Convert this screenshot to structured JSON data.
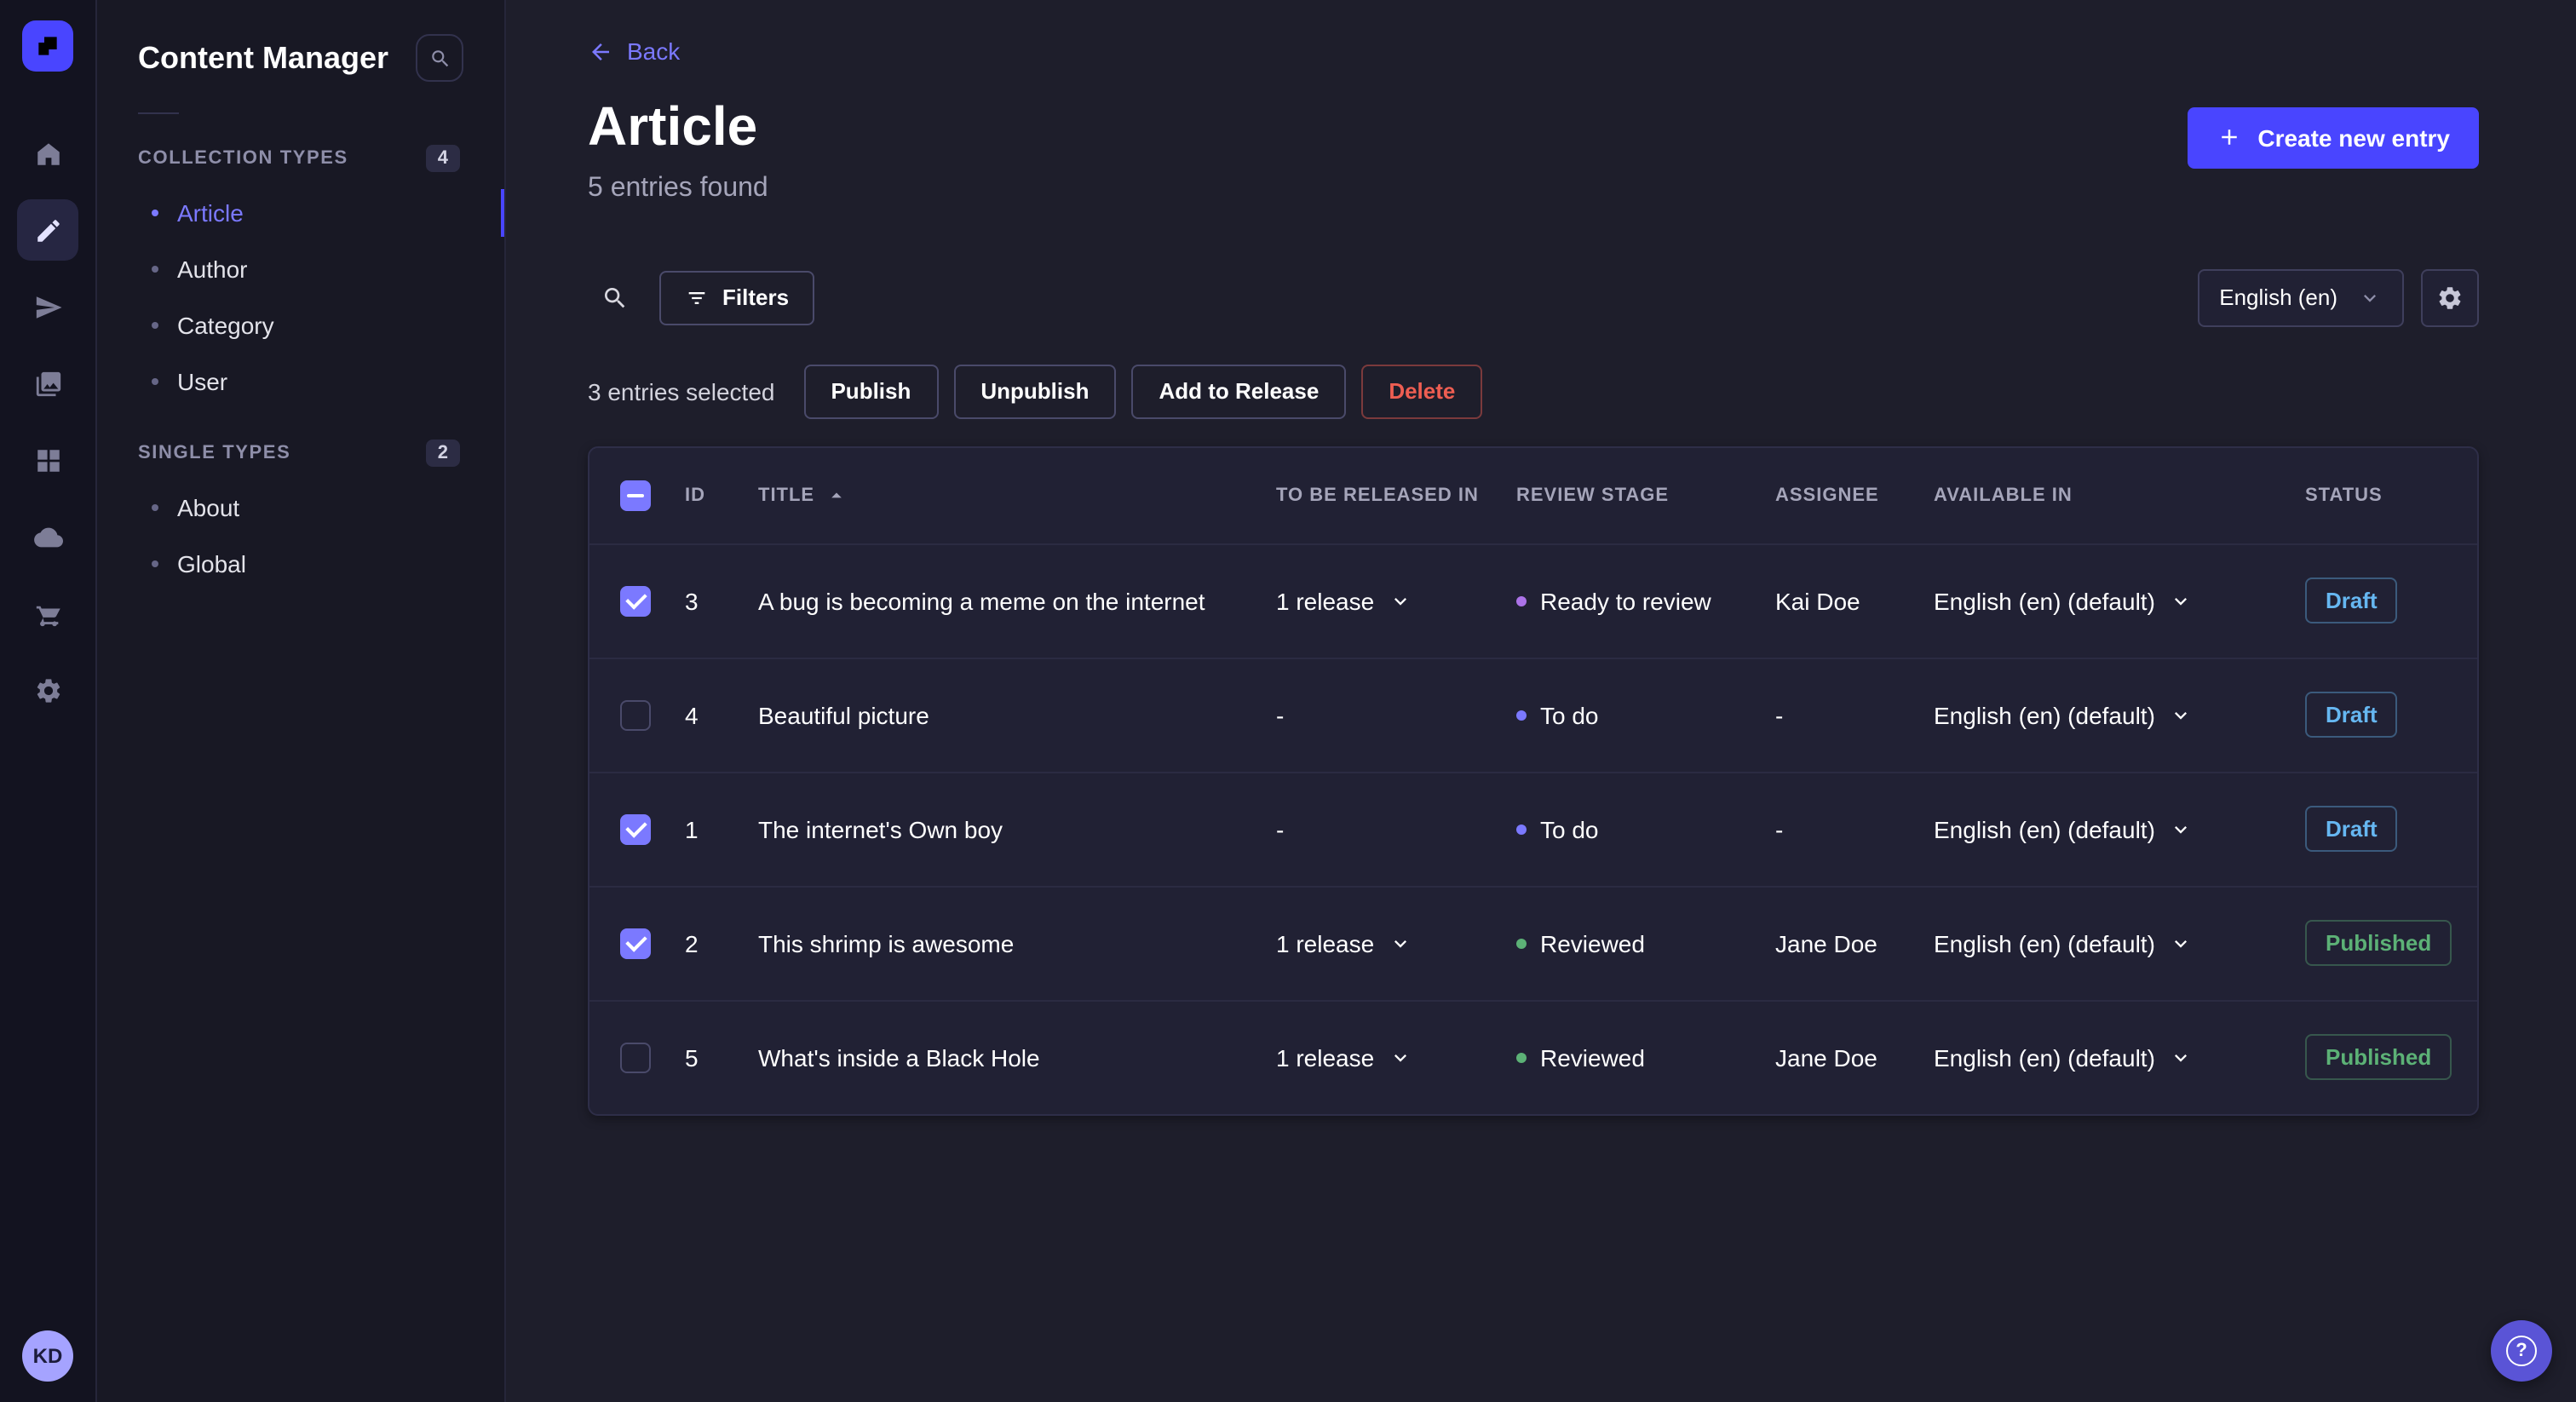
{
  "colors": {
    "accent": "#4945ff",
    "accent_light": "#7b79ff",
    "draft_status": "#66b7f1",
    "published_status": "#5cb176",
    "danger": "#ee5e52",
    "stage_ready_to_review": "#ac73e8",
    "stage_to_do": "#7b79ff",
    "stage_reviewed": "#5cb176"
  },
  "rail": {
    "logo_icon": "strapi-logo",
    "items": [
      {
        "name": "home",
        "icon": "home-icon"
      },
      {
        "name": "content-manager",
        "icon": "content-manager-icon",
        "active": true
      },
      {
        "name": "releases",
        "icon": "releases-icon"
      },
      {
        "name": "media-library",
        "icon": "media-library-icon"
      },
      {
        "name": "content-type-builder",
        "icon": "content-type-builder-icon"
      },
      {
        "name": "deployments",
        "icon": "cloud-icon"
      },
      {
        "name": "marketplace",
        "icon": "cart-icon"
      },
      {
        "name": "settings",
        "icon": "gear-icon"
      }
    ],
    "avatar_initials": "KD"
  },
  "sidebar": {
    "title": "Content Manager",
    "sections": [
      {
        "label": "COLLECTION TYPES",
        "badge": "4",
        "items": [
          {
            "label": "Article",
            "active": true
          },
          {
            "label": "Author"
          },
          {
            "label": "Category"
          },
          {
            "label": "User"
          }
        ]
      },
      {
        "label": "SINGLE TYPES",
        "badge": "2",
        "items": [
          {
            "label": "About"
          },
          {
            "label": "Global"
          }
        ]
      }
    ]
  },
  "header": {
    "back_label": "Back",
    "title": "Article",
    "subtitle": "5 entries found",
    "create_button_label": "Create new entry"
  },
  "toolbar": {
    "filters_label": "Filters",
    "locale_value": "English (en)"
  },
  "selection": {
    "text": "3 entries selected",
    "actions": [
      {
        "name": "publish-button",
        "label": "Publish"
      },
      {
        "name": "unpublish-button",
        "label": "Unpublish"
      },
      {
        "name": "add-to-release-button",
        "label": "Add to Release"
      },
      {
        "name": "delete-button",
        "label": "Delete",
        "variant": "danger"
      }
    ]
  },
  "table": {
    "select_all_state": "indeterminate",
    "headers": [
      "ID",
      "TITLE",
      "TO BE RELEASED IN",
      "REVIEW STAGE",
      "ASSIGNEE",
      "AVAILABLE IN",
      "STATUS"
    ],
    "sort": {
      "column": "TITLE",
      "direction": "asc"
    },
    "rows": [
      {
        "checked": true,
        "id": "3",
        "title": "A bug is becoming a meme on the internet",
        "released_in": "1 release",
        "review_stage": "Ready to review",
        "stage_color": "#ac73e8",
        "assignee": "Kai Doe",
        "available_in": "English (en) (default)",
        "status": "Draft"
      },
      {
        "checked": false,
        "id": "4",
        "title": "Beautiful picture",
        "released_in": "-",
        "review_stage": "To do",
        "stage_color": "#7b79ff",
        "assignee": "-",
        "available_in": "English (en) (default)",
        "status": "Draft"
      },
      {
        "checked": true,
        "id": "1",
        "title": "The internet's Own boy",
        "released_in": "-",
        "review_stage": "To do",
        "stage_color": "#7b79ff",
        "assignee": "-",
        "available_in": "English (en) (default)",
        "status": "Draft"
      },
      {
        "checked": true,
        "id": "2",
        "title": "This shrimp is awesome",
        "released_in": "1 release",
        "review_stage": "Reviewed",
        "stage_color": "#5cb176",
        "assignee": "Jane Doe",
        "available_in": "English (en) (default)",
        "status": "Published"
      },
      {
        "checked": false,
        "id": "5",
        "title": "What's inside a Black Hole",
        "released_in": "1 release",
        "review_stage": "Reviewed",
        "stage_color": "#5cb176",
        "assignee": "Jane Doe",
        "available_in": "English (en) (default)",
        "status": "Published"
      }
    ]
  },
  "help": {
    "label": "?"
  }
}
